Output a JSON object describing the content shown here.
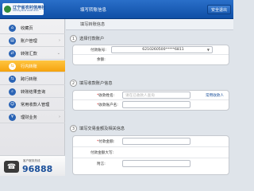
{
  "header": {
    "logo_cn": "辽宁省农村信用社",
    "logo_en": "Liaoning Rural Credit Union",
    "title": "填写转账信息",
    "logout_label": "安全退出"
  },
  "sidebar": {
    "items": [
      {
        "label": "收藏页",
        "icon": "home-icon"
      },
      {
        "label": "账户管理",
        "icon": "account-icon"
      },
      {
        "label": "转账汇款",
        "icon": "transfer-icon"
      },
      {
        "label": "行内转账",
        "icon": "in-bank-transfer-icon"
      },
      {
        "label": "跨行转账",
        "icon": "inter-bank-transfer-icon"
      },
      {
        "label": "转账结果查询",
        "icon": "result-query-icon"
      },
      {
        "label": "常用收款人管理",
        "icon": "payee-manage-icon"
      },
      {
        "label": "理财业务",
        "icon": "finance-icon"
      }
    ],
    "hotline_label": "客户服务热线",
    "hotline_number": "96888"
  },
  "main": {
    "heading": "填写转账信息",
    "step1": {
      "num": "1",
      "title": "选择付款账户",
      "account_label": "付款账号:",
      "account_value": "6210260500*****6811",
      "balance_label": "余额:"
    },
    "step2": {
      "num": "2",
      "title": "填写收款账户信息",
      "payee_name_label": "收款姓名:",
      "payee_name_placeholder": "请在已收款人查询",
      "common_payee_label": "常用收款人",
      "payee_account_label": "收款账户名:"
    },
    "step3": {
      "num": "3",
      "title": "填写交易金额及相关信息",
      "amount_label": "付款金额:",
      "amount_upper_label": "付款金额大写:",
      "remark_label": "附言:"
    }
  }
}
